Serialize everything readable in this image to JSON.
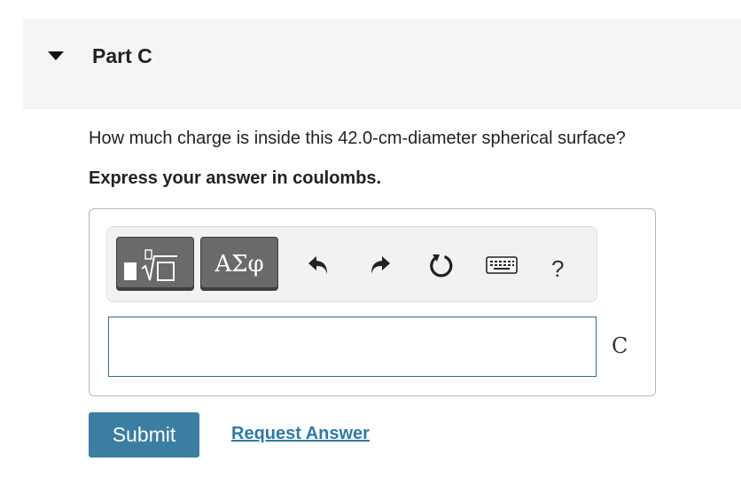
{
  "part": {
    "title": "Part C",
    "collapse_icon": "triangle-down-icon"
  },
  "question": {
    "text": "How much charge is inside this 42.0-cm-diameter spherical surface?",
    "instruction": "Express your answer in coulombs."
  },
  "toolbar": {
    "templates_icon": "math-templates-icon",
    "symbols_label": "ΑΣφ",
    "undo_icon": "undo-icon",
    "redo_icon": "redo-icon",
    "reset_icon": "reset-icon",
    "keyboard_icon": "keyboard-icon",
    "help_label": "?"
  },
  "answer": {
    "value": "",
    "unit": "C"
  },
  "actions": {
    "submit_label": "Submit",
    "request_label": "Request Answer"
  }
}
